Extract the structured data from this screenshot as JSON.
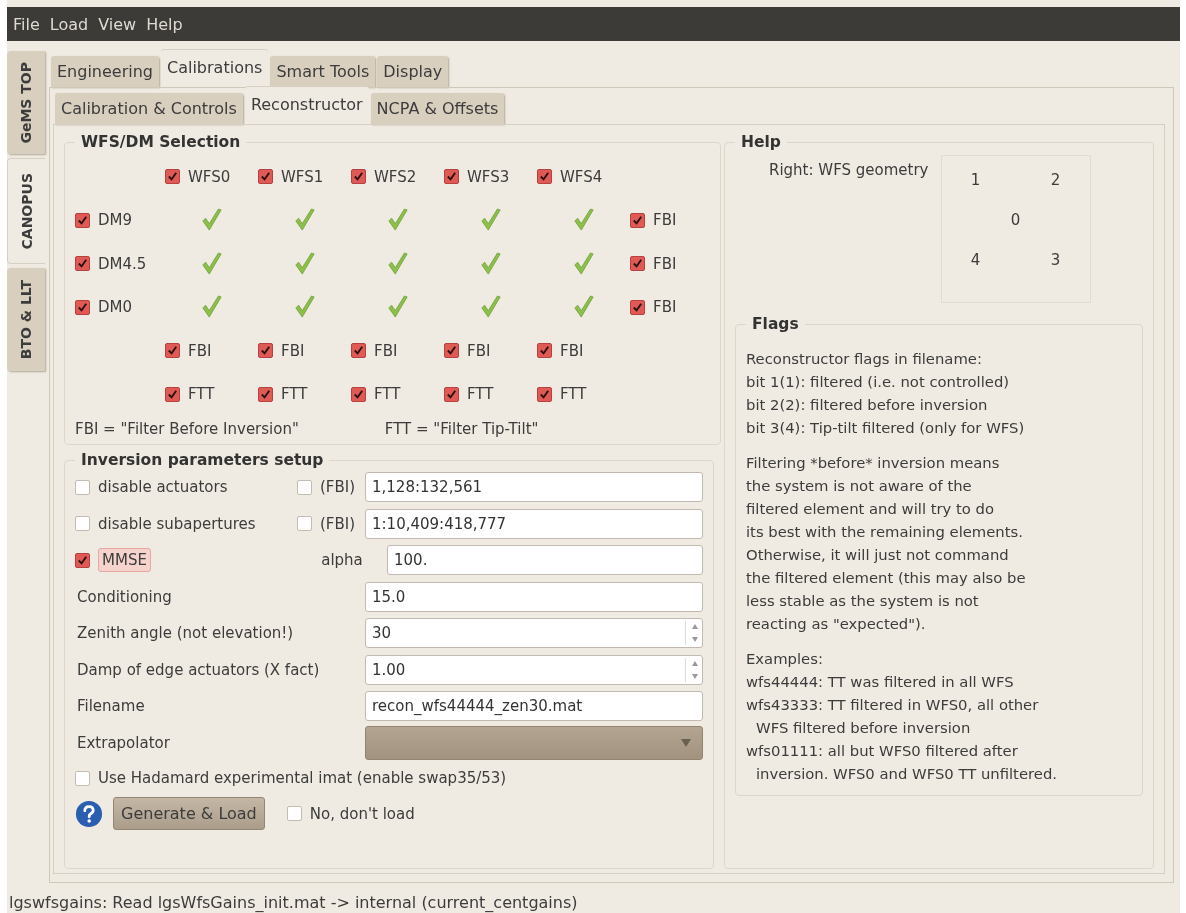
{
  "menu": [
    "File",
    "Load",
    "View",
    "Help"
  ],
  "side_tabs": [
    {
      "label": "GeMS TOP",
      "selected": false
    },
    {
      "label": "CANOPUS",
      "selected": true
    },
    {
      "label": "BTO & LLT",
      "selected": false
    }
  ],
  "tabs": [
    {
      "label": "Engineering",
      "selected": false
    },
    {
      "label": "Calibrations",
      "selected": true
    },
    {
      "label": "Smart Tools",
      "selected": false
    },
    {
      "label": "Display",
      "selected": false
    }
  ],
  "subtabs": [
    {
      "label": "Calibration & Controls",
      "selected": false
    },
    {
      "label": "Reconstructor",
      "selected": true
    },
    {
      "label": "NCPA & Offsets",
      "selected": false
    }
  ],
  "wfs_dm": {
    "title": "WFS/DM Selection",
    "wfs": [
      {
        "label": "WFS0",
        "checked": true
      },
      {
        "label": "WFS1",
        "checked": true
      },
      {
        "label": "WFS2",
        "checked": true
      },
      {
        "label": "WFS3",
        "checked": true
      },
      {
        "label": "WFS4",
        "checked": true
      }
    ],
    "dms": [
      {
        "label": "DM9",
        "checked": true,
        "links": [
          true,
          true,
          true,
          true,
          true
        ],
        "fbi": {
          "label": "FBI",
          "checked": true
        }
      },
      {
        "label": "DM4.5",
        "checked": true,
        "links": [
          true,
          true,
          true,
          true,
          true
        ],
        "fbi": {
          "label": "FBI",
          "checked": true
        }
      },
      {
        "label": "DM0",
        "checked": true,
        "links": [
          true,
          true,
          true,
          true,
          true
        ],
        "fbi": {
          "label": "FBI",
          "checked": true
        }
      }
    ],
    "fbi_row": [
      {
        "label": "FBI",
        "checked": true
      },
      {
        "label": "FBI",
        "checked": true
      },
      {
        "label": "FBI",
        "checked": true
      },
      {
        "label": "FBI",
        "checked": true
      },
      {
        "label": "FBI",
        "checked": true
      }
    ],
    "ftt_row": [
      {
        "label": "FTT",
        "checked": true
      },
      {
        "label": "FTT",
        "checked": true
      },
      {
        "label": "FTT",
        "checked": true
      },
      {
        "label": "FTT",
        "checked": true
      },
      {
        "label": "FTT",
        "checked": true
      }
    ],
    "legend_fbi": "FBI =  \"Filter Before Inversion\"",
    "legend_ftt": "FTT = \"Filter Tip-Tilt\""
  },
  "inversion": {
    "title": "Inversion parameters setup",
    "disables": [
      {
        "label": "disable actuators",
        "checked": false,
        "fbi": {
          "label": "(FBI)",
          "checked": false
        },
        "value": "1,128:132,561"
      },
      {
        "label": "disable subapertures",
        "checked": false,
        "fbi": {
          "label": "(FBI)",
          "checked": false
        },
        "value": "1:10,409:418,777"
      }
    ],
    "mmse": {
      "label": "MMSE",
      "checked": true,
      "alpha_label": "alpha",
      "alpha_value": "100."
    },
    "fields": [
      {
        "kind": "text",
        "label": "Conditioning",
        "value": "15.0"
      },
      {
        "kind": "spin",
        "label": "Zenith angle (not elevation!)",
        "value": "30"
      },
      {
        "kind": "spin",
        "label": "Damp of edge actuators (X fact)",
        "value": "1.00"
      },
      {
        "kind": "text",
        "label": "Filename",
        "value": "recon_wfs44444_zen30.mat"
      },
      {
        "kind": "combo",
        "label": "Extrapolator"
      }
    ],
    "hadamard": {
      "label": "Use Hadamard experimental imat (enable swap35/53)",
      "checked": false
    },
    "generate_button": "Generate & Load",
    "no_load": {
      "label": "No, don't load",
      "checked": false
    }
  },
  "help": {
    "title": "Help",
    "geometry_label": "Right: WFS geometry",
    "geometry": [
      "1",
      "2",
      "0",
      "4",
      "3"
    ],
    "flags_title": "Flags",
    "paragraphs": [
      [
        {
          "text": "Reconstructor flags in filename:"
        },
        {
          "text": "bit 1(1): filtered (i.e. not controlled)"
        },
        {
          "text": "bit 2(2): filtered before inversion"
        },
        {
          "text": "bit 3(4): Tip-tilt filtered (only for WFS)"
        }
      ],
      [
        {
          "text": "Filtering *before* inversion means"
        },
        {
          "text": "the system is not aware of the"
        },
        {
          "text": "filtered element and will try to do"
        },
        {
          "text": "its best with the remaining elements."
        },
        {
          "text": "Otherwise, it will just not command"
        },
        {
          "text": "the filtered element (this may also be"
        },
        {
          "text": "less stable as the system is not"
        },
        {
          "text": "reacting as \"expected\")."
        }
      ],
      [
        {
          "text": "Examples:"
        },
        {
          "text": "wfs44444: TT was filtered in all WFS"
        },
        {
          "text": "wfs43333: TT filtered in WFS0, all other",
          "children": [
            {
              "text": "WFS filtered before inversion"
            }
          ]
        },
        {
          "text": "wfs01111: all but WFS0 filtered after",
          "children": [
            {
              "text": "inversion. WFS0 and WFS0 TT unfiltered."
            }
          ]
        }
      ]
    ]
  },
  "status_bar": "lgswfsgains: Read lgsWfsGains_init.mat -> internal (current_centgains)"
}
